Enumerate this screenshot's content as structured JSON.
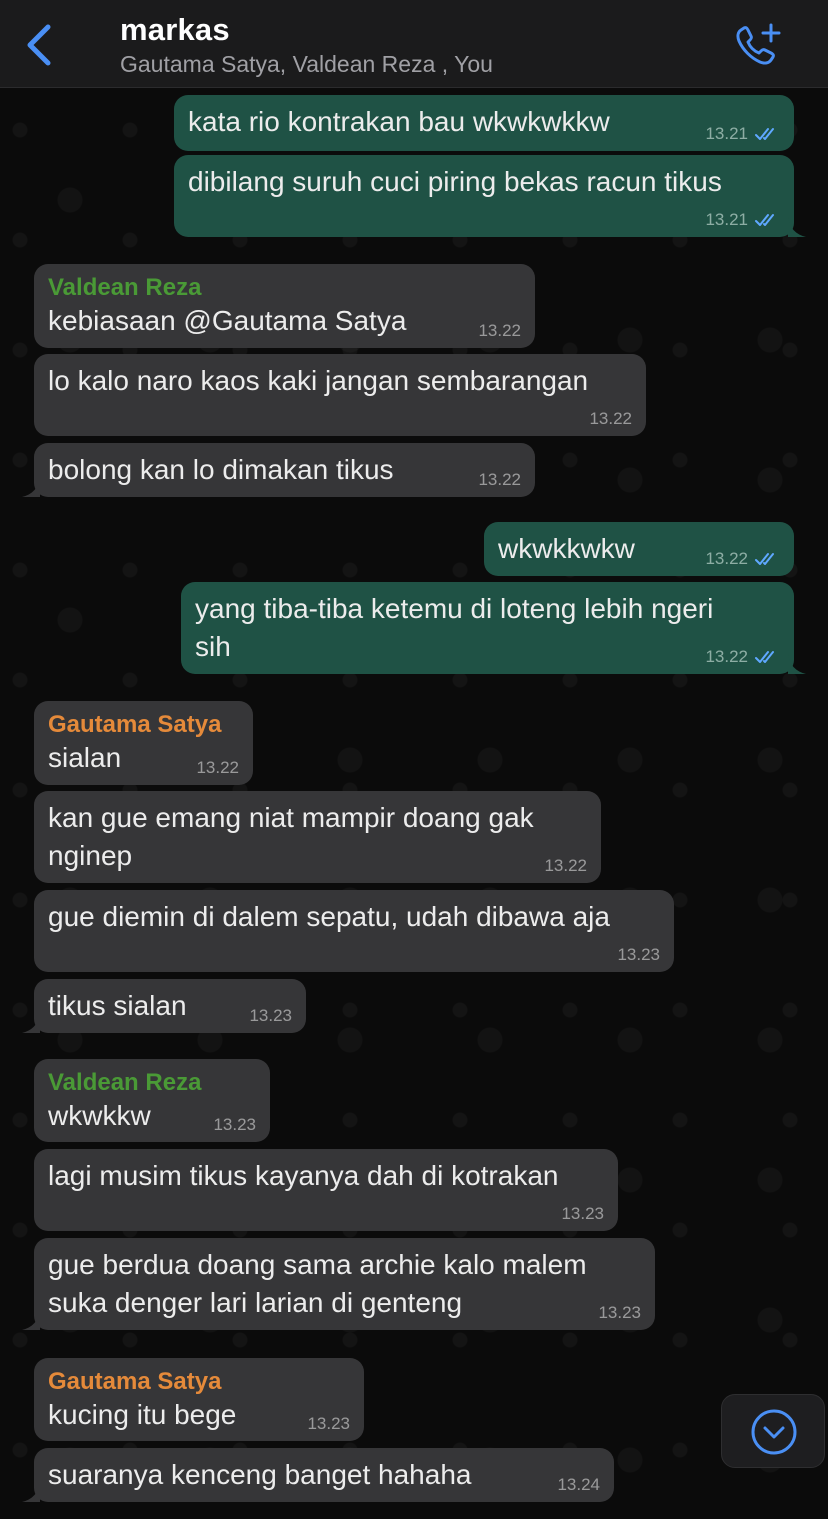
{
  "header": {
    "title": "markas",
    "participants": "Gautama Satya, Valdean Reza , You",
    "icons": {
      "back": "chevron-left-icon",
      "call": "add-call-icon"
    }
  },
  "colors": {
    "accent": "#4a8ff4",
    "outgoing_bubble": "#1f5245",
    "incoming_bubble": "#363638",
    "read_ticks": "#5fa8ff",
    "sender_valdean": "#4a9a36",
    "sender_gautama": "#e58a3a"
  },
  "messages": [
    {
      "direction": "out",
      "text": "kata rio kontrakan bau wkwkwkkw",
      "time": "13.21",
      "status": "read"
    },
    {
      "direction": "out",
      "text": "dibilang suruh cuci piring bekas racun tikus",
      "time": "13.21",
      "status": "read"
    },
    {
      "direction": "in",
      "sender": "Valdean Reza",
      "text": "kebiasaan @Gautama Satya",
      "time": "13.22"
    },
    {
      "direction": "in",
      "text": "lo kalo naro kaos kaki jangan sembarangan",
      "time": "13.22"
    },
    {
      "direction": "in",
      "text": "bolong kan lo dimakan tikus",
      "time": "13.22"
    },
    {
      "direction": "out",
      "text": "wkwkkwkw",
      "time": "13.22",
      "status": "read"
    },
    {
      "direction": "out",
      "text": "yang tiba-tiba ketemu di loteng lebih ngeri\nsih",
      "time": "13.22",
      "status": "read"
    },
    {
      "direction": "in",
      "sender": "Gautama Satya",
      "text": "sialan",
      "time": "13.22"
    },
    {
      "direction": "in",
      "text": "kan gue emang niat mampir doang gak\nnginep",
      "time": "13.22"
    },
    {
      "direction": "in",
      "text": "gue diemin di dalem sepatu, udah dibawa aja",
      "time": "13.23"
    },
    {
      "direction": "in",
      "text": "tikus sialan",
      "time": "13.23"
    },
    {
      "direction": "in",
      "sender": "Valdean Reza",
      "text": "wkwkkw",
      "time": "13.23"
    },
    {
      "direction": "in",
      "text": "lagi musim tikus kayanya dah di kotrakan",
      "time": "13.23"
    },
    {
      "direction": "in",
      "text": "gue berdua doang sama archie kalo malem\nsuka denger lari larian di genteng",
      "time": "13.23"
    },
    {
      "direction": "in",
      "sender": "Gautama Satya",
      "text": "kucing itu bege",
      "time": "13.23"
    },
    {
      "direction": "in",
      "text": "suaranya kenceng banget hahaha",
      "time": "13.24"
    }
  ],
  "scroll_button": {
    "icon": "chevron-down-circle-icon"
  }
}
